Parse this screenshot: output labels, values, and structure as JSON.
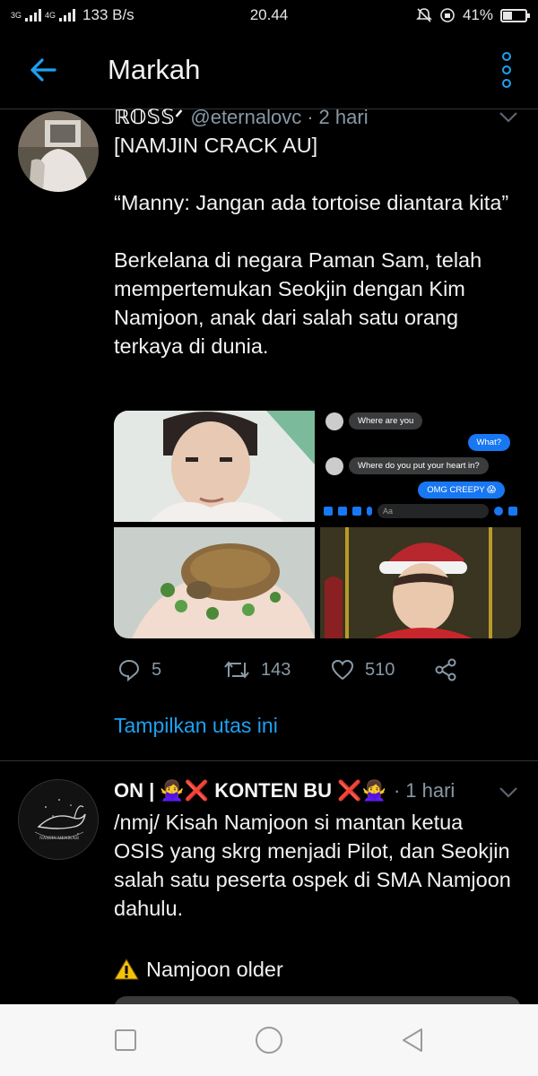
{
  "status_bar": {
    "network_left": "3G",
    "network_right": "4G",
    "speed": "133 B/s",
    "time": "20.44",
    "battery_text": "41%",
    "battery_level": 0.41
  },
  "header": {
    "title": "Markah",
    "back_icon": "arrow-left-icon",
    "more_icon": "vertical-dots-icon",
    "accent_color": "#1da1f2"
  },
  "tweets": [
    {
      "name": "ℝ𝕆𝕊𝕊ᐟ",
      "handle": "@eternalovc",
      "separator": "·",
      "time": "2 hari",
      "text": "[NAMJIN CRACK AU]\n\n“Manny: Jangan ada tortoise diantara kita”\n\nBerkelana di negara Paman Sam, telah mempertemukan Seokjin dengan Kim Namjoon, anak dari salah satu orang terkaya di dunia.",
      "chat": {
        "messages": [
          {
            "from": "other",
            "text": "Where are you"
          },
          {
            "from": "me",
            "text": "What?"
          },
          {
            "from": "other",
            "text": "Where do you put your heart in?"
          },
          {
            "from": "me",
            "text": "OMG CREEPY 😱"
          }
        ],
        "input_placeholder": "Aa"
      },
      "replies": "5",
      "retweets": "143",
      "likes": "510",
      "thread_link": "Tampilkan utas ini"
    },
    {
      "name": "ON | 🙅‍♀️❌ KONTEN BU ❌🙅‍♀️",
      "separator": "·",
      "time": "1 hari",
      "avatar_text": "NAMJIN MENIKAH",
      "text": "/nmj/ Kisah Namjoon si mantan ketua OSIS yang skrg menjadi Pilot, dan Seokjin salah satu peserta ospek di SMA Namjoon dahulu.",
      "warning_text": "Namjoon older"
    }
  ],
  "nav_bar": {
    "recent_icon": "square-icon",
    "home_icon": "circle-icon",
    "back_icon": "triangle-back-icon"
  }
}
